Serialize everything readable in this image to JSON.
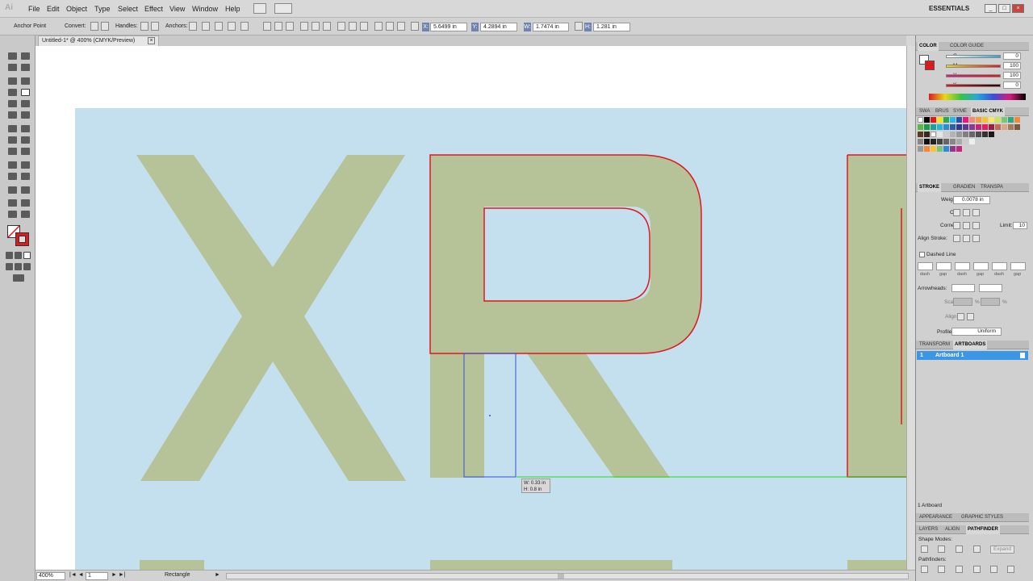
{
  "app": {
    "logo": "Ai"
  },
  "menu": [
    "File",
    "Edit",
    "Object",
    "Type",
    "Select",
    "Effect",
    "View",
    "Window",
    "Help"
  ],
  "workspace": "ESSENTIALS",
  "window_controls": [
    "_",
    "□",
    "×"
  ],
  "control_bar": {
    "selection": "Anchor Point",
    "convert_label": "Convert:",
    "handles_label": "Handles:",
    "anchors_label": "Anchors:",
    "x_label": "X:",
    "x_value": "5.6499 in",
    "y_label": "Y:",
    "y_value": "4.2894 in",
    "w_label": "W:",
    "w_value": "1.7474 in",
    "h_label": "H:",
    "h_value": "1.281 in"
  },
  "document_tab": {
    "title": "Untitled-1* @ 400% (CMYK/Preview)",
    "close": "×"
  },
  "canvas": {
    "letters": [
      "X",
      "R"
    ],
    "tooltip_w": "W: 0.33 in",
    "tooltip_h": "H: 0.8 in",
    "colors": {
      "background": "#c4e0ee",
      "letter": "#b6c298",
      "outline": "#e0191e",
      "selection": "#3a4fd8",
      "guide": "#28d828"
    }
  },
  "status_bar": {
    "zoom": "400%",
    "page": "1",
    "tool": "Rectangle"
  },
  "panels": {
    "color": {
      "tabs": [
        "COLOR",
        "COLOR GUIDE"
      ],
      "channels": [
        {
          "label": "C",
          "value": "0",
          "color": "#29a7d8"
        },
        {
          "label": "M",
          "value": "100",
          "color": "#d81c7a"
        },
        {
          "label": "Y",
          "value": "100",
          "color": "#e8d81a"
        },
        {
          "label": "K",
          "value": "0",
          "color": "#222222"
        }
      ]
    },
    "swatches": {
      "tabs": [
        "SWA",
        "BRUS",
        "SYME",
        "BASIC CMYK"
      ]
    },
    "stroke": {
      "tabs": [
        "STROKE",
        "GRADIEN",
        "TRANSPA"
      ],
      "weight_label": "Weight:",
      "weight_value": "0.0078 in",
      "cap_label": "Cap:",
      "corner_label": "Corner:",
      "limit_label": "Limit:",
      "limit_value": "10",
      "align_label": "Align Stroke:",
      "dashed_label": "Dashed Line",
      "dash_labels": [
        "dash",
        "gap",
        "dash",
        "gap",
        "dash",
        "gap"
      ],
      "arrowheads_label": "Arrowheads:",
      "scale_label": "Scale:",
      "scale_unit_1": "%",
      "scale_unit_2": "%",
      "align_arrow_label": "Align:",
      "profile_label": "Profile:",
      "profile_value": "Uniform"
    },
    "artboards": {
      "tabs": [
        "TRANSFORM",
        "ARTBOARDS"
      ],
      "items": [
        {
          "num": "1",
          "name": "Artboard 1"
        }
      ],
      "count": "1 Artboard"
    },
    "appearance": {
      "tabs": [
        "APPEARANCE",
        "GRAPHIC STYLES"
      ]
    },
    "pathfinder": {
      "tabs": [
        "LAYERS",
        "ALIGN",
        "PATHFINDER"
      ],
      "shape_modes": "Shape Modes:",
      "expand": "Expand",
      "pathfinders": "Pathfinders:"
    }
  }
}
